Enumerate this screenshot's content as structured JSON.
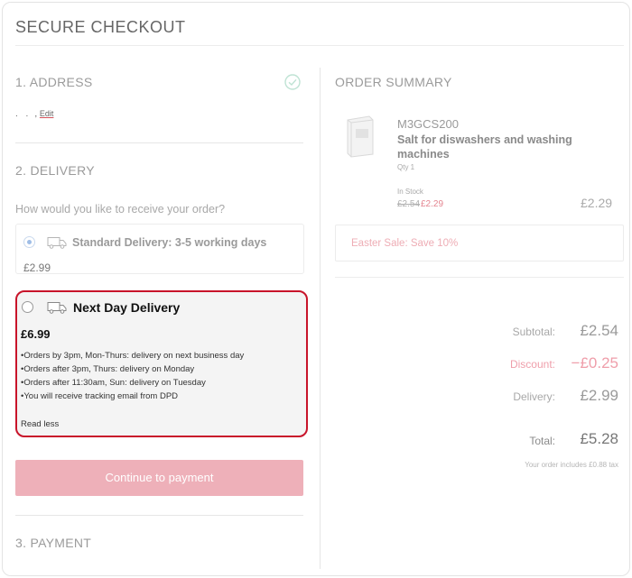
{
  "page": {
    "title": "SECURE CHECKOUT"
  },
  "address": {
    "heading": "1. ADDRESS",
    "dots": ". .",
    "sep": ",",
    "edit_label": "Edit"
  },
  "delivery": {
    "heading": "2. DELIVERY",
    "question": "How would you like to receive your order?",
    "standard": {
      "title": "Standard Delivery: 3-5 working days",
      "price": "£2.99"
    },
    "next_day": {
      "title": "Next Day Delivery",
      "price": "£6.99",
      "notes": [
        "•Orders by 3pm, Mon-Thurs: delivery on next business day",
        "•Orders after 3pm, Thurs: delivery on Monday",
        "•Orders after 11:30am, Sun: delivery on Tuesday",
        "•You will receive tracking email from DPD"
      ],
      "read_less": "Read less"
    },
    "continue_label": "Continue to payment"
  },
  "payment": {
    "heading": "3. PAYMENT"
  },
  "summary": {
    "heading": "ORDER SUMMARY",
    "product": {
      "code": "M3GCS200",
      "name": "Salt for diswashers and washing machines",
      "qty": "Qty 1",
      "stock": "In Stock",
      "old_price": "£2.54",
      "new_price": "£2.29",
      "line_price": "£2.29"
    },
    "promo": "Easter Sale: Save 10%",
    "totals": {
      "subtotal_label": "Subtotal:",
      "subtotal": "£2.54",
      "discount_label": "Discount:",
      "discount": "−£0.25",
      "delivery_label": "Delivery:",
      "delivery": "£2.99",
      "total_label": "Total:",
      "total": "£5.28",
      "tax_note": "Your order includes £0.88 tax"
    }
  },
  "colors": {
    "accent_red": "#c8142a",
    "button_pink": "#eeb0b9",
    "check_green": "#bfe3d4"
  },
  "icons": {
    "address_done": "check-circle-icon",
    "van": "delivery-van-icon",
    "product": "product-thumbnail"
  },
  "selected_delivery": "standard"
}
